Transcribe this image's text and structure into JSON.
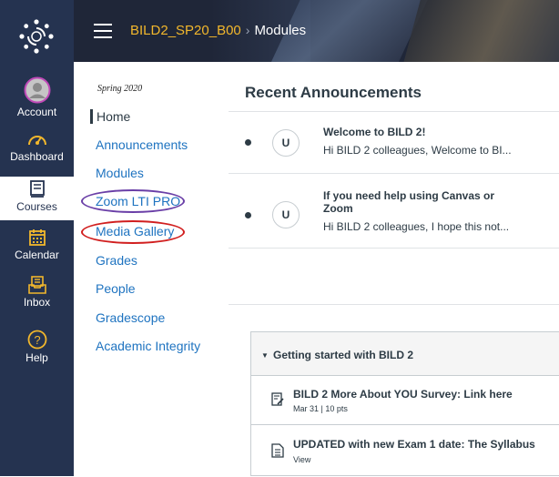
{
  "global_nav": {
    "account": "Account",
    "dashboard": "Dashboard",
    "courses": "Courses",
    "calendar": "Calendar",
    "inbox": "Inbox",
    "help": "Help"
  },
  "header": {
    "course": "BILD2_SP20_B00",
    "separator": "›",
    "page": "Modules"
  },
  "course_nav": {
    "term": "Spring 2020",
    "items": [
      "Home",
      "Announcements",
      "Modules",
      "Zoom LTI PRO",
      "Media Gallery",
      "Grades",
      "People",
      "Gradescope",
      "Academic Integrity"
    ]
  },
  "announcements": {
    "title": "Recent Announcements",
    "items": [
      {
        "avatar": "U",
        "title": "Welcome to BILD 2!",
        "body": "Hi BILD 2 colleagues, Welcome to BI..."
      },
      {
        "avatar": "U",
        "title": "If you need help using Canvas or Zoom",
        "body": "Hi BILD 2 colleagues, I hope this not..."
      }
    ]
  },
  "module": {
    "title": "Getting started with BILD 2",
    "items": [
      {
        "name": "BILD 2 More About YOU Survey: Link here",
        "meta": "Mar 31  |  10 pts"
      },
      {
        "name": "UPDATED with new Exam 1 date: The Syllabus",
        "meta": "View"
      }
    ]
  },
  "colors": {
    "nav_bg": "#253350",
    "link": "#1e73c0",
    "course_title": "#f2b72c",
    "zoom_circle": "#6a3fa7",
    "media_circle": "#d11f1f"
  }
}
